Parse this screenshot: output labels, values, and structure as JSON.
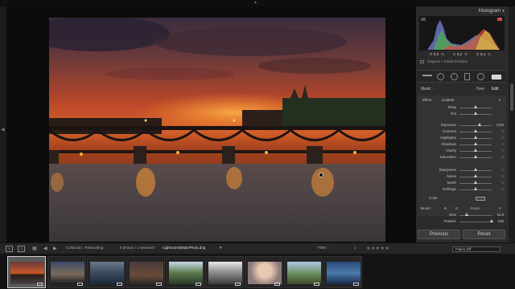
{
  "top_panel_toggle": "▲",
  "left_panel_toggle": "◀",
  "photo": {
    "description_icon": "paris-sunset-photo"
  },
  "histogram": {
    "title": "Histogram",
    "stats": {
      "r_label": "R",
      "r_value": "8.2",
      "g_label": "G",
      "g_value": "6.2",
      "b_label": "B",
      "b_value": "5.1",
      "unit": "%"
    },
    "original_label": "Original + Smart Preview"
  },
  "mask": {
    "label": "Mask :",
    "new_label": "New",
    "edit_label": "Edit"
  },
  "effect": {
    "label": "Effect :",
    "preset": "Custom"
  },
  "sliders": [
    {
      "label": "Temp",
      "value": "",
      "pos": 0.5
    },
    {
      "label": "Tint",
      "value": "",
      "pos": 0.5
    },
    {
      "label": "Exposure",
      "value": "0.62",
      "pos": 0.62
    },
    {
      "label": "Contrast",
      "value": "0",
      "pos": 0.5
    },
    {
      "label": "Highlights",
      "value": "0",
      "pos": 0.5
    },
    {
      "label": "Shadows",
      "value": "0",
      "pos": 0.5
    },
    {
      "label": "Clarity",
      "value": "0",
      "pos": 0.5
    },
    {
      "label": "Saturation",
      "value": "0",
      "pos": 0.5
    },
    {
      "label": "Sharpness",
      "value": "0",
      "pos": 0.5
    },
    {
      "label": "Noise",
      "value": "0",
      "pos": 0.5
    },
    {
      "label": "Moiré",
      "value": "0",
      "pos": 0.5
    },
    {
      "label": "Defringe",
      "value": "0",
      "pos": 0.5
    }
  ],
  "color_label": "Color",
  "brush": {
    "label": "Brush :",
    "a": "A",
    "b": "B",
    "erase": "Erase",
    "size_label": "Size",
    "size_value": "11.0",
    "feather_label": "Feather",
    "feather_value": "100"
  },
  "buttons": {
    "previous": "Previous",
    "reset": "Reset"
  },
  "filmstrip_bar": {
    "view1": "1",
    "view2": "2",
    "collection": "Collection : Retouching",
    "count": "9 photos / 1 selected /",
    "filename": "LightroomSMainPhoto.dng",
    "filter_label": "Filter :",
    "stars": "★★★★★",
    "filter_value": "Filters Off"
  },
  "colors": {
    "panel": "#2b2b2b",
    "canvas": "#0c0c0c",
    "accent": "#cfcfcf"
  }
}
